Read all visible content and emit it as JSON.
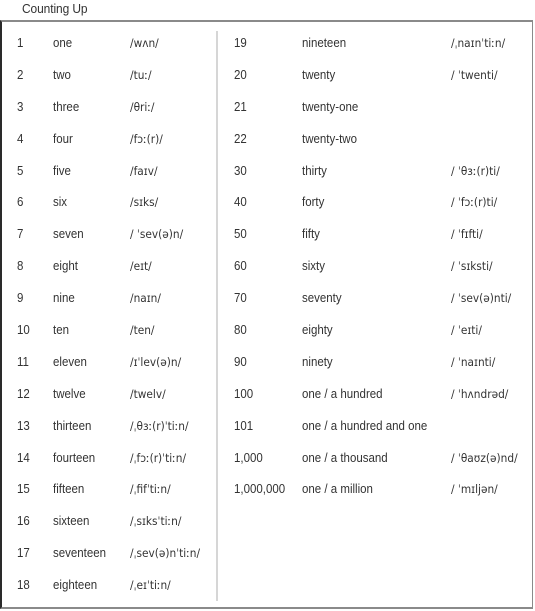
{
  "title": "Counting Up",
  "left_column": [
    {
      "number": "1",
      "word": "one",
      "ipa": "/wʌn/"
    },
    {
      "number": "2",
      "word": "two",
      "ipa": "/tuː/"
    },
    {
      "number": "3",
      "word": "three",
      "ipa": "/θriː/"
    },
    {
      "number": "4",
      "word": "four",
      "ipa": "/fɔː(r)/"
    },
    {
      "number": "5",
      "word": "five",
      "ipa": "/faɪv/"
    },
    {
      "number": "6",
      "word": "six",
      "ipa": "/sɪks/"
    },
    {
      "number": "7",
      "word": "seven",
      "ipa": "/ ˈsev(ə)n/"
    },
    {
      "number": "8",
      "word": "eight",
      "ipa": "/eɪt/"
    },
    {
      "number": "9",
      "word": "nine",
      "ipa": "/naɪn/"
    },
    {
      "number": "10",
      "word": "ten",
      "ipa": "/ten/"
    },
    {
      "number": "11",
      "word": "eleven",
      "ipa": "/ɪˈlev(ə)n/"
    },
    {
      "number": "12",
      "word": "twelve",
      "ipa": "/twelv/"
    },
    {
      "number": "13",
      "word": "thirteen",
      "ipa": "/ˌθɜː(r)ˈtiːn/"
    },
    {
      "number": "14",
      "word": "fourteen",
      "ipa": "/ˌfɔː(r)ˈtiːn/"
    },
    {
      "number": "15",
      "word": "fifteen",
      "ipa": "/ˌfifˈtiːn/"
    },
    {
      "number": "16",
      "word": "sixteen",
      "ipa": "/ˌsɪksˈtiːn/"
    },
    {
      "number": "17",
      "word": "seventeen",
      "ipa": "/ˌsev(ə)nˈtiːn/"
    },
    {
      "number": "18",
      "word": "eighteen",
      "ipa": "/ˌeɪˈtiːn/"
    }
  ],
  "right_column": [
    {
      "number": "19",
      "word": "nineteen",
      "ipa": "/ˌnaɪnˈtiːn/"
    },
    {
      "number": "20",
      "word": "twenty",
      "ipa": "/ ˈtwenti/"
    },
    {
      "number": "21",
      "word": "twenty-one",
      "ipa": ""
    },
    {
      "number": "22",
      "word": "twenty-two",
      "ipa": ""
    },
    {
      "number": "30",
      "word": "thirty",
      "ipa": "/ ˈθɜː(r)ti/"
    },
    {
      "number": "40",
      "word": "forty",
      "ipa": "/ ˈfɔː(r)ti/"
    },
    {
      "number": "50",
      "word": "fifty",
      "ipa": "/ ˈfɪfti/"
    },
    {
      "number": "60",
      "word": "sixty",
      "ipa": "/ ˈsɪksti/"
    },
    {
      "number": "70",
      "word": "seventy",
      "ipa": "/ ˈsev(ə)nti/"
    },
    {
      "number": "80",
      "word": "eighty",
      "ipa": "/ ˈeɪti/"
    },
    {
      "number": "90",
      "word": "ninety",
      "ipa": "/ ˈnaɪnti/"
    },
    {
      "number": "100",
      "word": "one / a hundred",
      "ipa": "/ ˈhʌndrəd/"
    },
    {
      "number": "101",
      "word": "one / a hundred and one",
      "ipa": ""
    },
    {
      "number": "1,000",
      "word": "one / a thousand",
      "ipa": "/ ˈθaʊz(ə)nd/"
    },
    {
      "number": "1,000,000",
      "word": "one / a million",
      "ipa": "/ ˈmɪljən/"
    }
  ]
}
